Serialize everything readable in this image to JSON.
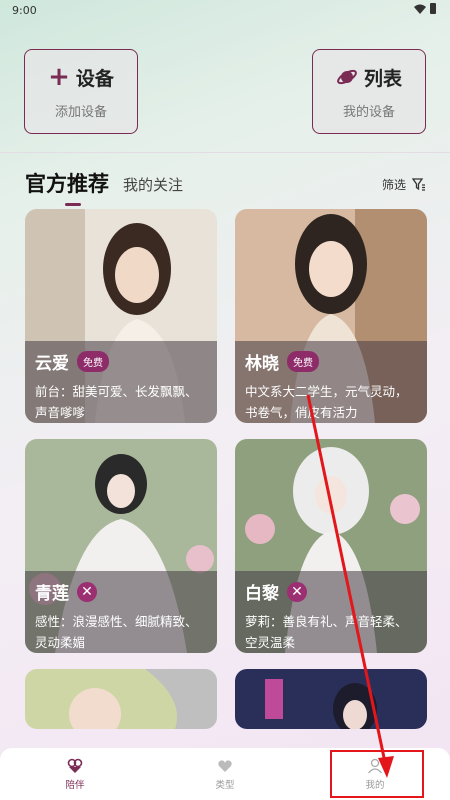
{
  "status": {
    "time": "9:00"
  },
  "top_buttons": {
    "device": {
      "label": "设备",
      "sub": "添加设备"
    },
    "list": {
      "label": "列表",
      "sub": "我的设备"
    }
  },
  "tabs": {
    "active": "官方推荐",
    "other": "我的关注"
  },
  "filter_label": "筛选",
  "cards": [
    {
      "name": "云爱",
      "badge": "免费",
      "desc": "前台：甜美可爱、长发飘飘、声音嗲嗲"
    },
    {
      "name": "林晓",
      "badge": "免费",
      "desc": "中文系大二学生，元气灵动，书卷气，俏皮有活力"
    },
    {
      "name": "青莲",
      "badge": "",
      "desc": "感性：浪漫感性、细腻精致、灵动柔媚"
    },
    {
      "name": "白黎",
      "badge": "",
      "desc": "萝莉：善良有礼、声音轻柔、空灵温柔"
    }
  ],
  "nav": [
    {
      "label": "陪伴"
    },
    {
      "label": "类型"
    },
    {
      "label": "我的"
    }
  ],
  "colors": {
    "accent": "#7a2c55",
    "highlight": "#e3161c"
  }
}
